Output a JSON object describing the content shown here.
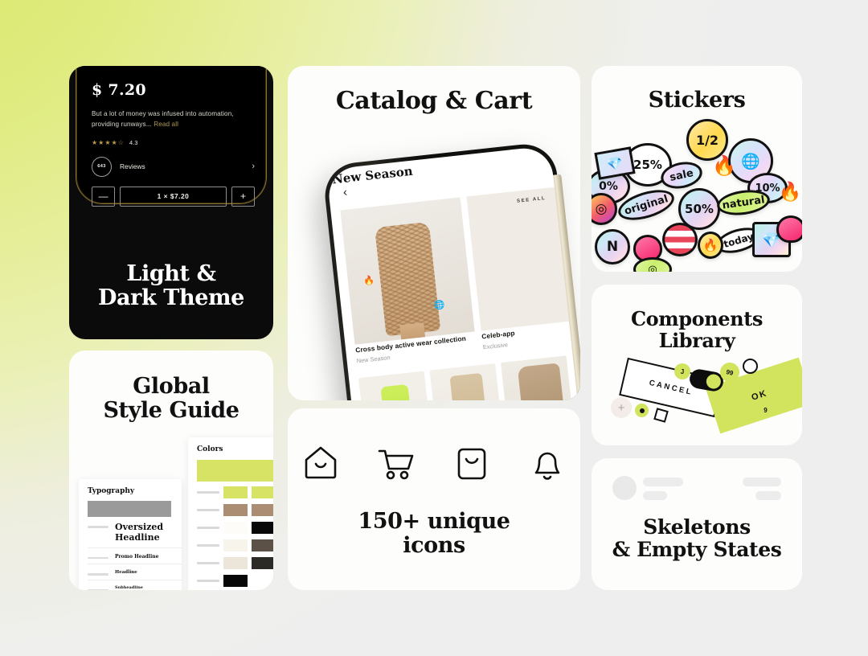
{
  "background": {
    "accent": "#dbe86a",
    "base": "#eeeeee"
  },
  "cards": {
    "theme": {
      "title_line1": "Light &",
      "title_line2": "Dark Theme",
      "phone": {
        "price": "$ 7.20",
        "description": "But a lot of money was infused into automation, providing runways...",
        "read_all": "Read all",
        "stars": "★★★★☆",
        "rating": "4.3",
        "review_count": "643",
        "reviews_label": "Reviews",
        "chevron": "›",
        "minus": "—",
        "plus": "+",
        "quantity": "1 × $7.20"
      }
    },
    "style_guide": {
      "title_line1": "Global",
      "title_line2": "Style Guide",
      "colors_heading": "Colors",
      "typography_heading": "Typography",
      "type_samples": [
        "Oversized Headline",
        "Promo Headline",
        "Headline",
        "Subheadline"
      ],
      "swatches": [
        {
          "a": "#d7e364",
          "b": "#d7e364"
        },
        {
          "a": "#ab8d73",
          "b": "#ab8d73"
        },
        {
          "a": "#fdfcf8",
          "b": "#080808"
        },
        {
          "a": "#f7f4ec",
          "b": "#5c5146"
        },
        {
          "a": "#ece5da",
          "b": "#2b2a27"
        },
        {
          "a": "#070707",
          "b": ""
        }
      ]
    },
    "catalog": {
      "title": "Catalog & Cart",
      "phone": {
        "back": "‹",
        "hero_title": "New Season",
        "see_all": "SEE ALL",
        "item1_title": "Cross body active wear collection",
        "item1_sub": "New Season",
        "item2_title": "Celeb-app",
        "item2_sub": "Exclusive",
        "sticker_flame": "🔥",
        "sticker_globe": "🌐"
      }
    },
    "icons": {
      "title_line1": "150+ unique",
      "title_line2": "icons",
      "items": [
        "home-icon",
        "cart-icon",
        "bag-icon",
        "bell-icon"
      ]
    },
    "stickers": {
      "title": "Stickers",
      "items": [
        {
          "label": "1/2",
          "name": "sticker-half"
        },
        {
          "label": "25%",
          "name": "sticker-25-percent"
        },
        {
          "label": "0%",
          "name": "sticker-0-percent"
        },
        {
          "label": "sale",
          "name": "sticker-sale"
        },
        {
          "label": "50%",
          "name": "sticker-50-percent"
        },
        {
          "label": "10%",
          "name": "sticker-10-percent"
        },
        {
          "label": "original",
          "name": "sticker-original"
        },
        {
          "label": "natural",
          "name": "sticker-natural"
        },
        {
          "label": "today",
          "name": "sticker-today"
        },
        {
          "label": "🔥",
          "name": "sticker-flame"
        },
        {
          "label": "🇺🇸",
          "name": "sticker-usa-flag"
        },
        {
          "label": "💎",
          "name": "sticker-diamond"
        },
        {
          "label": "❤",
          "name": "sticker-heart"
        }
      ]
    },
    "components": {
      "title_line1": "Components",
      "title_line2": "Library",
      "cancel_label": "CANCEL",
      "ok_label": "OK",
      "badge_99": "99",
      "badge_9": "9",
      "badge_j": "J"
    },
    "skeleton": {
      "title_line1": "Skeletons",
      "title_line2": "& Empty States"
    }
  }
}
